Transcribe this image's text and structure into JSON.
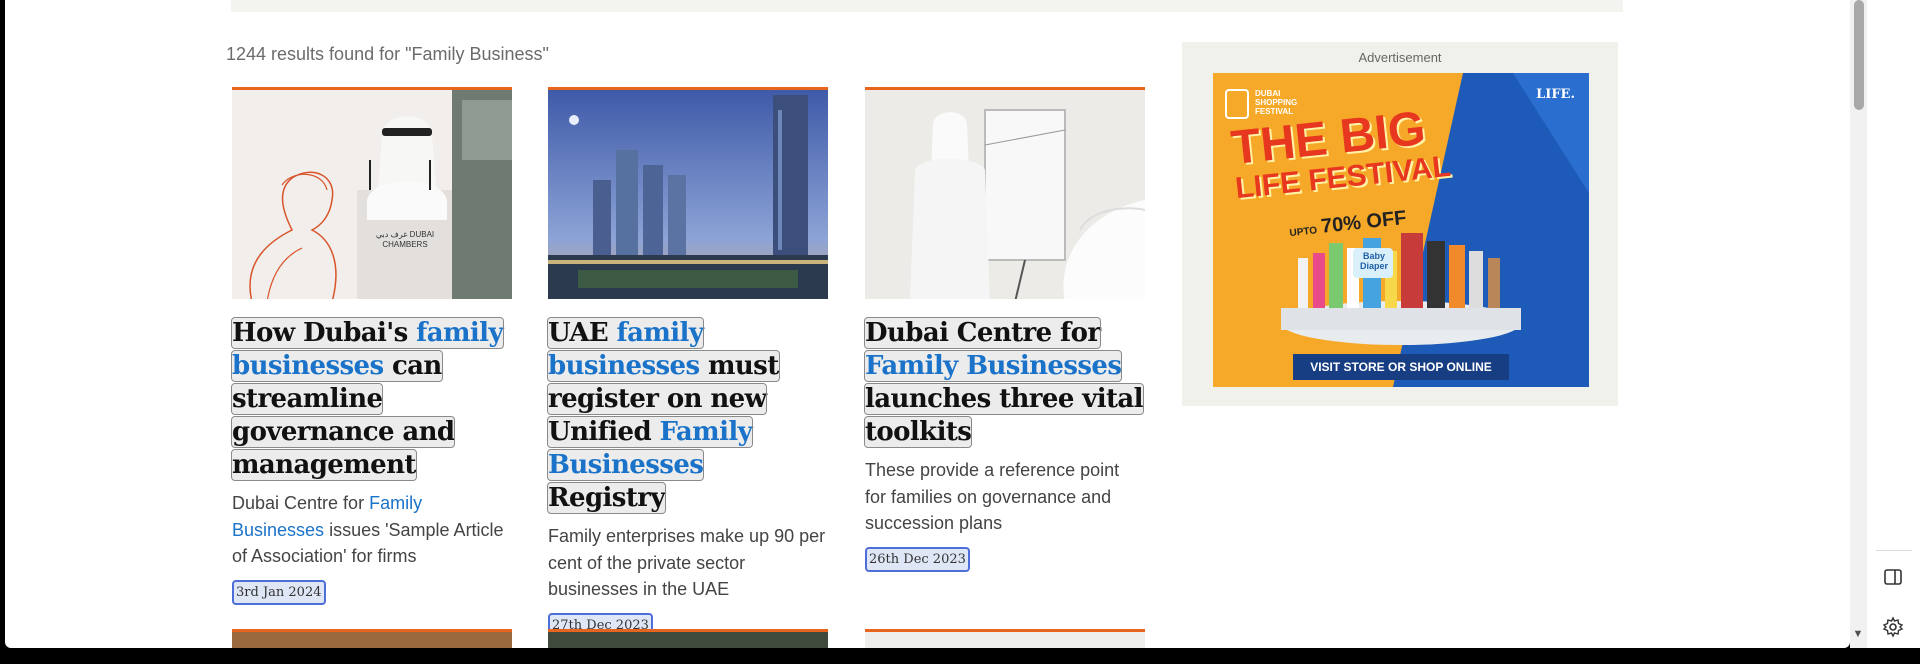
{
  "search": {
    "results_text": "1244 results found for \"Family Business\""
  },
  "cards": [
    {
      "title_parts": [
        "How Dubai's ",
        "family businesses",
        " can streamline governance and management"
      ],
      "desc_parts": [
        "Dubai Centre for ",
        "Family Businesses",
        " issues 'Sample Article of Association' for firms"
      ],
      "date": "3rd Jan 2024",
      "image_text": "غرف دبي DUBAI CHAMBERS"
    },
    {
      "title_parts": [
        "UAE ",
        "family businesses",
        " must register on new Unified ",
        "Family Businesses",
        " Registry"
      ],
      "desc": "Family enterprises make up 90 per cent of the private sector businesses in the UAE",
      "date": "27th Dec 2023"
    },
    {
      "title_parts": [
        "Dubai Centre for ",
        "Family Businesses",
        " launches three vital toolkits"
      ],
      "desc": "These provide a reference point for families on governance and succession plans",
      "date": "26th Dec 2023"
    }
  ],
  "ad": {
    "label": "Advertisement",
    "festival_logo": "DUBAI SHOPPING FESTIVAL",
    "brand_logo": "LIFE.",
    "headline_line1": "THE BIG",
    "headline_line2": "LIFE FESTIVAL",
    "offer_upto": "UPTO",
    "offer_value": "70% OFF",
    "product_tag": "Baby Diaper",
    "cta": "VISIT STORE OR SHOP ONLINE"
  },
  "colors": {
    "accent_orange": "#e8651f",
    "highlight_blue": "#1a73c8",
    "ad_orange": "#f6a928",
    "ad_blue": "#1e5bb8"
  }
}
